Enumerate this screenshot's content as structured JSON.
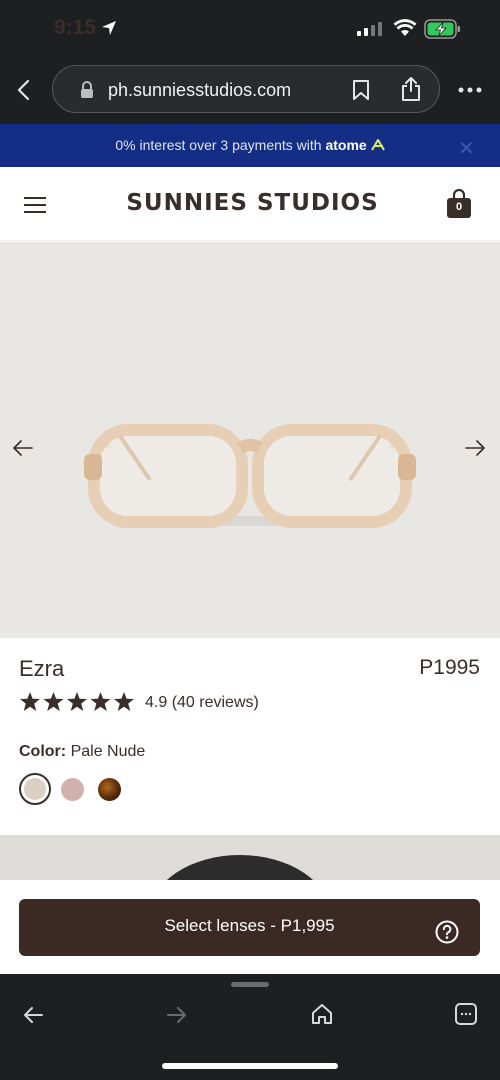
{
  "status": {
    "time": "9:15"
  },
  "browser": {
    "url": "ph.sunniesstudios.com"
  },
  "promo": {
    "text": "0% interest over 3 payments with ",
    "brand": "atome"
  },
  "header": {
    "logo": "SUNNIES STUDIOS",
    "cart_count": "0"
  },
  "product": {
    "name": "Ezra",
    "price": "P1995",
    "rating_text": "4.9 (40 reviews)",
    "rating": 4.9,
    "color_label": "Color:",
    "color_value": "Pale Nude",
    "swatches": [
      {
        "name": "Pale Nude",
        "color": "#d9cfc3"
      },
      {
        "name": "pink",
        "color": "#d1b1ac"
      },
      {
        "name": "tortoise",
        "color": "#6b3310"
      }
    ]
  },
  "cta": {
    "label": "Select lenses - P1,995"
  },
  "colors": {
    "promo_bg": "#142e86",
    "brand_dark": "#3b2a24",
    "hero_bg": "#e8e7e3"
  }
}
